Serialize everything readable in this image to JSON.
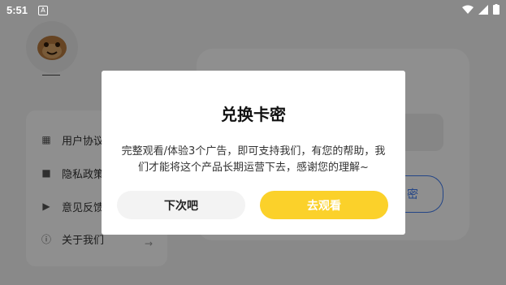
{
  "status_bar": {
    "time": "5:51",
    "notification_icon": "A"
  },
  "profile": {
    "avatar_icon": "smiling-face-avatar"
  },
  "menu": {
    "items": [
      {
        "label": "用户协议",
        "icon": "document-icon"
      },
      {
        "label": "隐私政策",
        "icon": "lock-icon"
      },
      {
        "label": "意见反馈",
        "icon": "send-icon"
      },
      {
        "label": "关于我们",
        "icon": "info-icon"
      }
    ]
  },
  "background": {
    "button_label": "密"
  },
  "dialog": {
    "title": "兑换卡密",
    "message": "完整观看/体验3个广告，即可支持我们，有您的帮助，我们才能将这个产品长期运营下去，感谢您的理解~",
    "cancel_label": "下次吧",
    "confirm_label": "去观看"
  },
  "colors": {
    "accent": "#fbd12a",
    "link_blue": "#3f7cf0"
  }
}
